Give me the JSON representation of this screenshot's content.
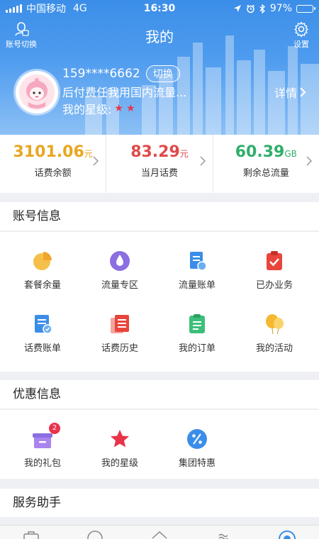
{
  "status": {
    "carrier": "中国移动",
    "network": "4G",
    "time": "16:30",
    "battery": "97%",
    "battery_level": 0.97
  },
  "header": {
    "title": "我的",
    "switch_account_label": "账号切换",
    "settings_label": "设置",
    "phone": "159****6662",
    "switch_label": "切换",
    "plan": "后付费任我用国内流量...",
    "star_level_label": "我的星级:",
    "star_count": 2,
    "star_color": "#e8334a",
    "detail_label": "详情"
  },
  "stats": [
    {
      "value": "3101.06",
      "unit": "元",
      "label": "话费余额",
      "color": "#e9a620"
    },
    {
      "value": "83.29",
      "unit": "元",
      "label": "当月话费",
      "color": "#e04b4b"
    },
    {
      "value": "60.39",
      "unit": "GB",
      "label": "剩余总流量",
      "color": "#2fae6a"
    }
  ],
  "account_section": {
    "title": "账号信息",
    "items": [
      {
        "label": "套餐余量",
        "icon": "pie-chart-icon"
      },
      {
        "label": "流量专区",
        "icon": "data-drop-icon"
      },
      {
        "label": "流量账单",
        "icon": "data-bill-icon"
      },
      {
        "label": "已办业务",
        "icon": "clipboard-check-icon"
      },
      {
        "label": "话费账单",
        "icon": "bill-icon"
      },
      {
        "label": "话费历史",
        "icon": "history-list-icon"
      },
      {
        "label": "我的订单",
        "icon": "order-icon"
      },
      {
        "label": "我的活动",
        "icon": "balloon-icon"
      }
    ]
  },
  "promo_section": {
    "title": "优惠信息",
    "items": [
      {
        "label": "我的礼包",
        "icon": "gift-icon",
        "badge": "2"
      },
      {
        "label": "我的星级",
        "icon": "star-icon"
      },
      {
        "label": "集团特惠",
        "icon": "percent-icon"
      }
    ]
  },
  "service_section": {
    "title": "服务助手"
  },
  "colors": {
    "primary": "#3b8ee8",
    "badge": "#e8334a"
  }
}
